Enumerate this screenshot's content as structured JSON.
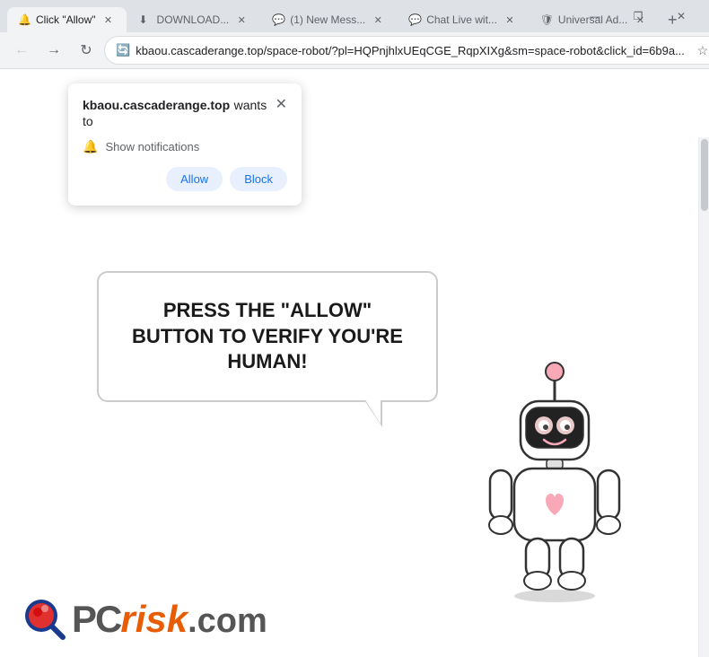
{
  "tabs": [
    {
      "id": "tab1",
      "label": "DOWNLOAD...",
      "active": false,
      "favicon": "⬇"
    },
    {
      "id": "tab2",
      "label": "(1) New Mess...",
      "active": false,
      "favicon": "💬"
    },
    {
      "id": "tab3",
      "label": "Chat Live wit...",
      "active": false,
      "favicon": "💬"
    },
    {
      "id": "tab4",
      "label": "Click \"Allow\"",
      "active": true,
      "favicon": "🔔"
    },
    {
      "id": "tab5",
      "label": "Universal Ad...",
      "active": false,
      "favicon": "🛡"
    }
  ],
  "address_bar": {
    "url": "kbaou.cascaderange.top/space-robot/?pl=HQPnjhlxUEqCGE_RqpXIXg&sm=space-robot&click_id=6b9a...",
    "secure_icon": "🔄"
  },
  "notification_popup": {
    "site_name": "kbaou.cascaderange.top",
    "wants_text": "wants",
    "to_text": "to",
    "notification_label": "Show notifications",
    "allow_label": "Allow",
    "block_label": "Block"
  },
  "page": {
    "speech_text": "PRESS THE \"ALLOW\" BUTTON TO VERIFY YOU'RE HUMAN!",
    "pcrisk_pc": "PC",
    "pcrisk_risk": "risk",
    "pcrisk_com": ".com"
  },
  "window_controls": {
    "minimize": "—",
    "restore": "❐",
    "close": "✕"
  }
}
